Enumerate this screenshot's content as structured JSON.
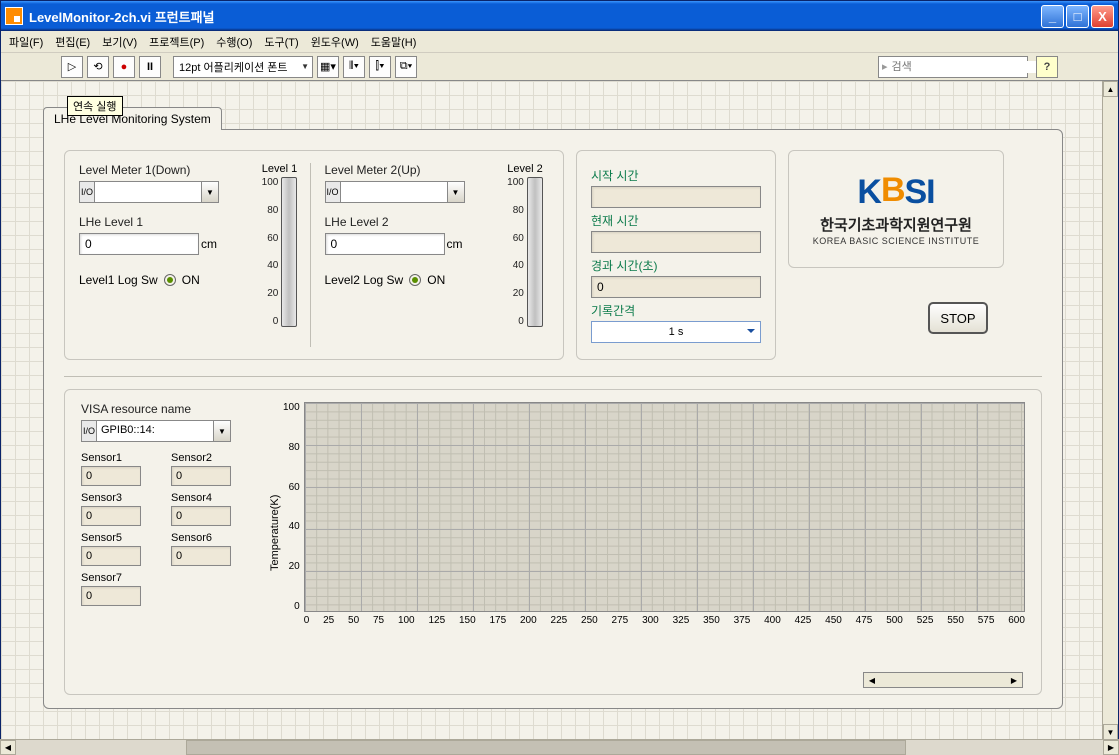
{
  "window": {
    "title": "LevelMonitor-2ch.vi 프런트패널"
  },
  "menu": {
    "file": "파일(F)",
    "edit": "편집(E)",
    "view": "보기(V)",
    "project": "프로젝트(P)",
    "operate": "수행(O)",
    "tools": "도구(T)",
    "window": "윈도우(W)",
    "help": "도움말(H)"
  },
  "toolbar": {
    "font_label": "12pt 어플리케이션 폰트",
    "search_placeholder": "검색",
    "tooltip": "연속 실행"
  },
  "tab": {
    "label": "LHe Level Monitoring System"
  },
  "level1": {
    "meter_label": "Level Meter 1(Down)",
    "lhe_label": "LHe Level 1",
    "lhe_value": "0",
    "unit": "cm",
    "log_label": "Level1 Log Sw",
    "log_state": "ON",
    "gauge_caption": "Level 1"
  },
  "level2": {
    "meter_label": "Level Meter 2(Up)",
    "lhe_label": "LHe Level 2",
    "lhe_value": "0",
    "unit": "cm",
    "log_label": "Level2 Log Sw",
    "log_state": "ON",
    "gauge_caption": "Level 2"
  },
  "gauge_ticks": [
    "100",
    "80",
    "60",
    "40",
    "20",
    "0"
  ],
  "time": {
    "start_label": "시작 시간",
    "start_value": "",
    "now_label": "현재 시간",
    "now_value": "",
    "elapsed_label": "경과 시간(초)",
    "elapsed_value": "0",
    "interval_label": "기록간격",
    "interval_value": "1 s"
  },
  "logo": {
    "abbrev": "KBSI",
    "korean": "한국기초과학지원연구원",
    "english": "KOREA BASIC SCIENCE INSTITUTE"
  },
  "stop_label": "STOP",
  "visa": {
    "label": "VISA resource name",
    "value": "GPIB0::14:"
  },
  "sensors": {
    "s1": {
      "label": "Sensor1",
      "value": "0"
    },
    "s2": {
      "label": "Sensor2",
      "value": "0"
    },
    "s3": {
      "label": "Sensor3",
      "value": "0"
    },
    "s4": {
      "label": "Sensor4",
      "value": "0"
    },
    "s5": {
      "label": "Sensor5",
      "value": "0"
    },
    "s6": {
      "label": "Sensor6",
      "value": "0"
    },
    "s7": {
      "label": "Sensor7",
      "value": "0"
    }
  },
  "chart_data": {
    "type": "line",
    "title": "",
    "xlabel": "",
    "ylabel": "Temperature(K)",
    "x_ticks": [
      "0",
      "25",
      "50",
      "75",
      "100",
      "125",
      "150",
      "175",
      "200",
      "225",
      "250",
      "275",
      "300",
      "325",
      "350",
      "375",
      "400",
      "425",
      "450",
      "475",
      "500",
      "525",
      "550",
      "575",
      "600"
    ],
    "y_ticks": [
      "100",
      "80",
      "60",
      "40",
      "20",
      "0"
    ],
    "xlim": [
      0,
      600
    ],
    "ylim": [
      0,
      100
    ],
    "series": []
  }
}
